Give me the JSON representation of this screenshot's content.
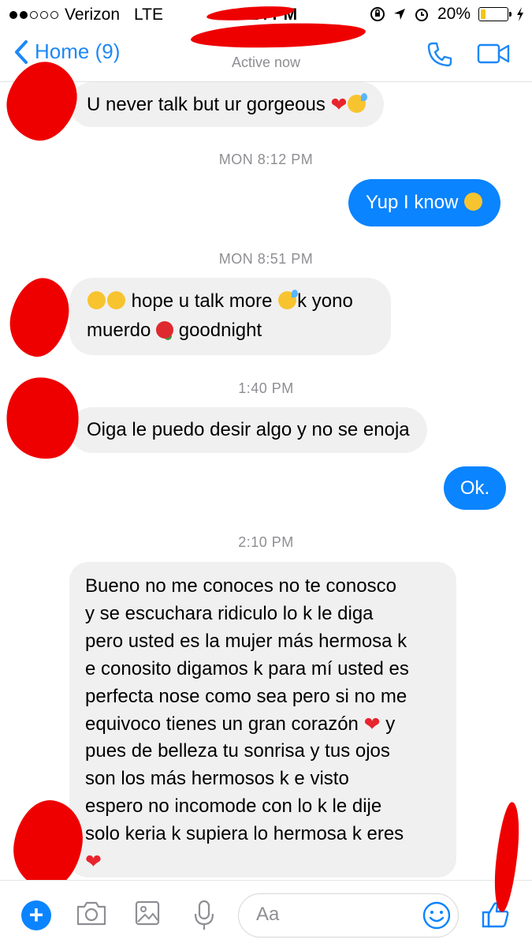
{
  "status_bar": {
    "carrier": "Verizon",
    "network": "LTE",
    "time": "2:14 PM",
    "battery": "20%",
    "battery_level": 0.2
  },
  "header": {
    "back_label": "Home (9)",
    "contact_name": "",
    "status": "Active now"
  },
  "messages": {
    "m1": "U never talk but ur gorgeous",
    "ts1": "MON 8:12 PM",
    "m2": "Yup I know",
    "ts2": "MON 8:51 PM",
    "m3_part1": "hope u talk more",
    "m3_part2": "k yono",
    "m3_part3": "muerdo",
    "m3_part4": "goodnight",
    "ts3": "1:40 PM",
    "m4": "Oiga le puedo desir algo y no se enoja",
    "m5": "Ok.",
    "ts4": "2:10 PM",
    "m6_lines": [
      "Bueno no me conoces no te conosco",
      "y se escuchara ridiculo lo k le diga",
      "pero usted es la mujer más hermosa k",
      "e conosito digamos k para mí usted es",
      "perfecta nose como sea pero si no me",
      "equivoco tienes un gran corazón",
      "pues de belleza tu sonrisa y tus ojos",
      "son los más hermosos k e visto",
      "espero no incomode con lo k le dije",
      "solo keria k supiera lo hermosa k eres"
    ],
    "m6_line6_tail": "y"
  },
  "composer": {
    "placeholder": "Aa"
  },
  "colors": {
    "accent": "#0a84ff",
    "incoming_bubble": "#f0f0f0",
    "redaction": "#ee0000"
  }
}
